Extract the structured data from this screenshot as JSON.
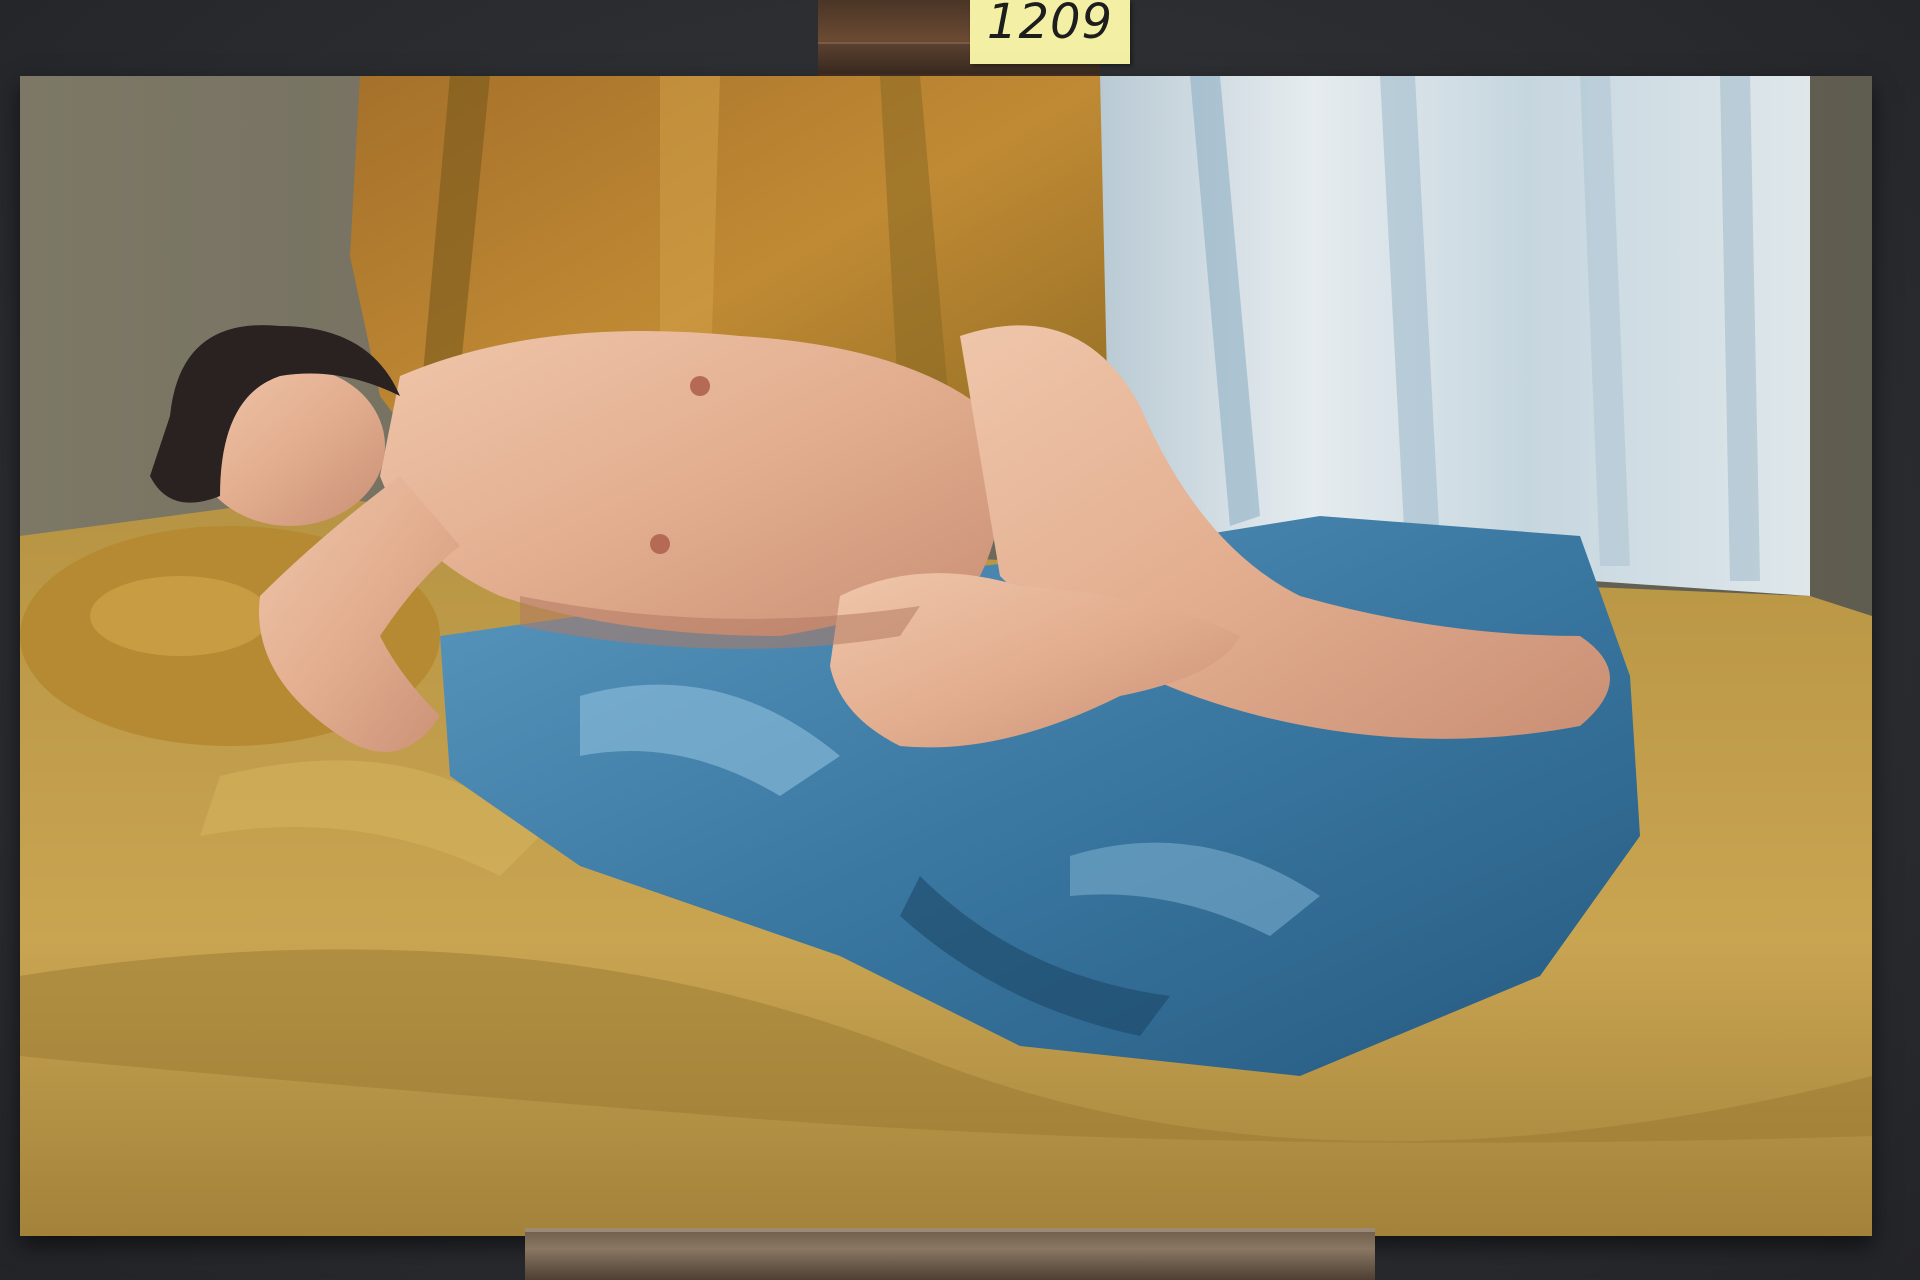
{
  "lot_tag": {
    "number": "1209"
  },
  "painting": {
    "subject": "reclining-nude-figure-icon",
    "palette": {
      "drape_gold": "#b88a2e",
      "drape_ochre": "#8a6520",
      "curtain_white": "#dfe6ea",
      "curtain_blue": "#9fb8c8",
      "cloth_blue": "#3f7fa8",
      "cloth_blue_dark": "#245a80",
      "bed_gold": "#c9a24a",
      "skin": "#e8b79a",
      "skin_shadow": "#c68d72",
      "hair": "#2a2220",
      "wall_grey": "#6e6a5c"
    }
  }
}
